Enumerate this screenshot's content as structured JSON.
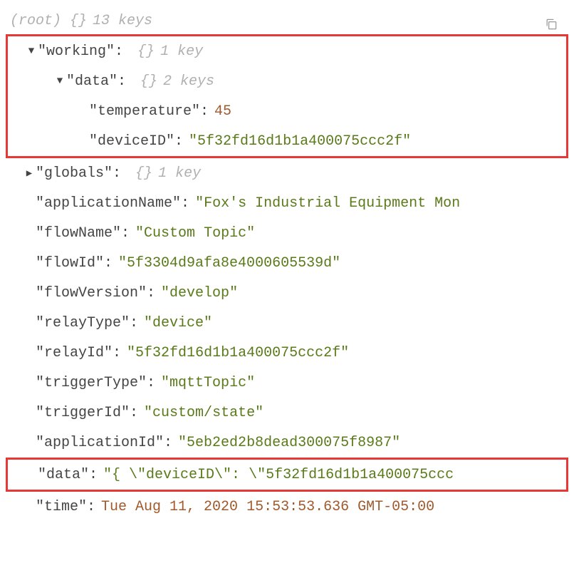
{
  "root": {
    "label": "(root)",
    "brace": "{}",
    "count": "13 keys"
  },
  "copyIcon": "copy-icon",
  "working": {
    "key": "\"working\"",
    "brace": "{}",
    "count": "1 key",
    "data": {
      "key": "\"data\"",
      "brace": "{}",
      "count": "2 keys",
      "temperature": {
        "key": "\"temperature\"",
        "value": "45"
      },
      "deviceID": {
        "key": "\"deviceID\"",
        "value": "\"5f32fd16d1b1a400075ccc2f\""
      }
    }
  },
  "globals": {
    "key": "\"globals\"",
    "brace": "{}",
    "count": "1 key"
  },
  "applicationName": {
    "key": "\"applicationName\"",
    "value": "\"Fox's Industrial Equipment Mon"
  },
  "flowName": {
    "key": "\"flowName\"",
    "value": "\"Custom Topic\""
  },
  "flowId": {
    "key": "\"flowId\"",
    "value": "\"5f3304d9afa8e4000605539d\""
  },
  "flowVersion": {
    "key": "\"flowVersion\"",
    "value": "\"develop\""
  },
  "relayType": {
    "key": "\"relayType\"",
    "value": "\"device\""
  },
  "relayId": {
    "key": "\"relayId\"",
    "value": "\"5f32fd16d1b1a400075ccc2f\""
  },
  "triggerType": {
    "key": "\"triggerType\"",
    "value": "\"mqttTopic\""
  },
  "triggerId": {
    "key": "\"triggerId\"",
    "value": "\"custom/state\""
  },
  "applicationId": {
    "key": "\"applicationId\"",
    "value": "\"5eb2ed2b8dead300075f8987\""
  },
  "data": {
    "key": "\"data\"",
    "value": "\"{ \\\"deviceID\\\": \\\"5f32fd16d1b1a400075ccc"
  },
  "time": {
    "key": "\"time\"",
    "value": "Tue Aug 11, 2020 15:53:53.636 GMT-05:00"
  }
}
